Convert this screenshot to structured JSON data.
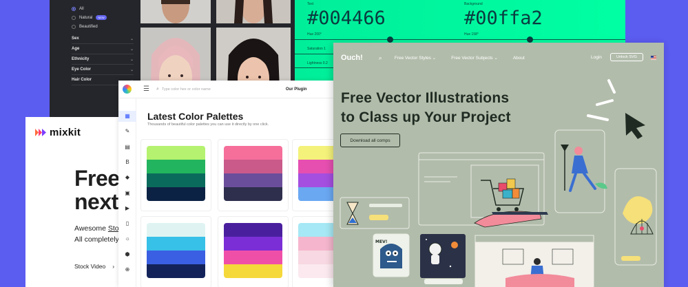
{
  "faces_app": {
    "radio_options": [
      {
        "label": "All",
        "selected": true,
        "badge": ""
      },
      {
        "label": "Natural",
        "selected": false,
        "badge": "NEW"
      },
      {
        "label": "Beautified",
        "selected": false,
        "badge": ""
      }
    ],
    "filters": [
      "Sex",
      "Age",
      "Ethnicity",
      "Eye Color",
      "Hair Color"
    ]
  },
  "color_converter": {
    "left": {
      "label": "Text",
      "hex": "#004466",
      "meta1": "Hue 200°",
      "meta2": "Saturation 1",
      "meta3": "Lightness 0.2"
    },
    "right": {
      "label": "Background",
      "hex": "#00ffa2",
      "meta1": "Hue 158°"
    }
  },
  "mixkit": {
    "logo": "mixkit",
    "headline_line1": "Free",
    "headline_line2": "next",
    "sub_line1_prefix": "Awesome ",
    "sub_line1_link": "Stoc",
    "sub_line2": "All completely",
    "link_label": "Stock Video",
    "link_arrow": "›"
  },
  "palettes_app": {
    "search_placeholder": "Type color hex or color name",
    "plugins_label": "Our Plugin",
    "title": "Latest Color Palettes",
    "subtitle": "Thousands of beautiful color palettes you can use it directly by one click.",
    "rail_icons": [
      {
        "name": "palette-grid-icon",
        "glyph": "▦",
        "active": true
      },
      {
        "name": "pen-icon",
        "glyph": "✎",
        "active": false
      },
      {
        "name": "gradient-icon",
        "glyph": "▤",
        "active": false
      },
      {
        "name": "bold-icon",
        "glyph": "B",
        "active": false
      },
      {
        "name": "fill-icon",
        "glyph": "◆",
        "active": false
      },
      {
        "name": "image-icon",
        "glyph": "▣",
        "active": false
      },
      {
        "name": "video-icon",
        "glyph": "▶",
        "active": false
      },
      {
        "name": "file-icon",
        "glyph": "▯",
        "active": false
      },
      {
        "name": "sun-icon",
        "glyph": "☼",
        "active": false
      },
      {
        "name": "cube-icon",
        "glyph": "⬢",
        "active": false
      },
      {
        "name": "globe-icon",
        "glyph": "⊕",
        "active": false
      }
    ],
    "palettes": [
      {
        "colors": [
          "#b5f26f",
          "#22b45e",
          "#0a6b5c",
          "#0c2244"
        ]
      },
      {
        "colors": [
          "#f56f9a",
          "#c95a8a",
          "#6b4e9b",
          "#2e2f4d"
        ]
      },
      {
        "colors": [
          "#f4f27a",
          "#e64fb0",
          "#a44fe0",
          "#6aa8f2"
        ]
      },
      {
        "colors": [
          "#dff4f2",
          "#37c0e8",
          "#3b5fe2",
          "#13235a"
        ]
      },
      {
        "colors": [
          "#4a1f9e",
          "#7b2ed6",
          "#f04fa8",
          "#f5d83a"
        ]
      },
      {
        "colors": [
          "#a6e8f5",
          "#f5b6cd",
          "#f8d8e2",
          "#fbe9ef"
        ]
      }
    ]
  },
  "ouch_app": {
    "logo": "Ouch!",
    "nav": [
      "Free Vector Styles",
      "Free Vector Subjects",
      "About"
    ],
    "login": "Login",
    "unlock": "Unlock SVG",
    "headline_line1": "Free Vector Illustrations",
    "headline_line2": "to Class up Your Project",
    "cta": "Download all comps",
    "sticker_text": "MEV!"
  },
  "colors": {
    "page_bg": "#5b5cf0",
    "green": "#00ffa2",
    "ouch_bg": "#b2bcab",
    "ouch_dark": "#1f2b22"
  }
}
